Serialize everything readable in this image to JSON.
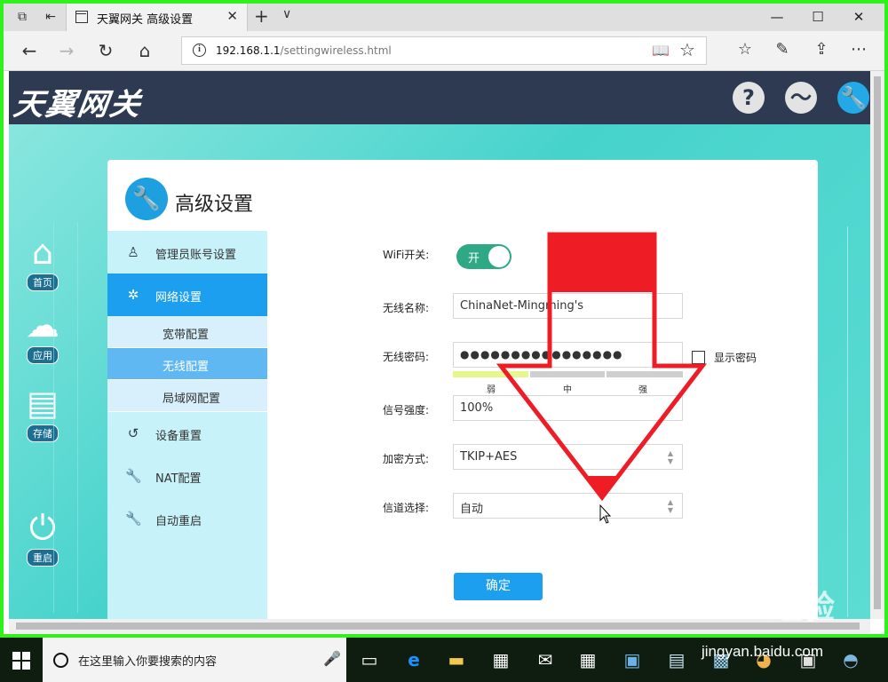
{
  "browser": {
    "tab_title": "天翼网关 高级设置",
    "url_host": "192.168.1.1",
    "url_path": "/settingwireless.html"
  },
  "header": {
    "logo": "天翼网关"
  },
  "sidebar": {
    "items": [
      {
        "label": "首页"
      },
      {
        "label": "应用"
      },
      {
        "label": "存储"
      },
      {
        "label": "重启"
      }
    ]
  },
  "panel": {
    "title": "高级设置"
  },
  "menu": {
    "items": [
      {
        "label": "管理员账号设置"
      },
      {
        "label": "网络设置"
      },
      {
        "label": "宽带配置"
      },
      {
        "label": "无线配置"
      },
      {
        "label": "局域网配置"
      },
      {
        "label": "设备重置"
      },
      {
        "label": "NAT配置"
      },
      {
        "label": "自动重启"
      }
    ]
  },
  "form": {
    "wifi_switch_label": "WiFi开关:",
    "wifi_switch_state": "开",
    "ssid_label": "无线名称:",
    "ssid_value": "ChinaNet-Mingming's",
    "password_label": "无线密码:",
    "password_value": "●●●●●●●●●●●●●●●●",
    "strength_levels": [
      "弱",
      "中",
      "强"
    ],
    "show_password_label": "显示密码",
    "signal_label": "信号强度:",
    "signal_value": "100%",
    "encryption_label": "加密方式:",
    "encryption_value": "TKIP+AES",
    "channel_label": "信道选择:",
    "channel_value": "自动",
    "confirm_label": "确定"
  },
  "taskbar": {
    "search_placeholder": "在这里输入你要搜索的内容"
  },
  "watermark": {
    "brand": "Baidu经验",
    "site": "jingyan.baidu.com"
  },
  "colors": {
    "accent": "#1d9ff0",
    "toggle_on": "#2fa985",
    "banner": "#2d3a52",
    "arrow": "#ee1c25",
    "frame": "#2ff21d"
  }
}
